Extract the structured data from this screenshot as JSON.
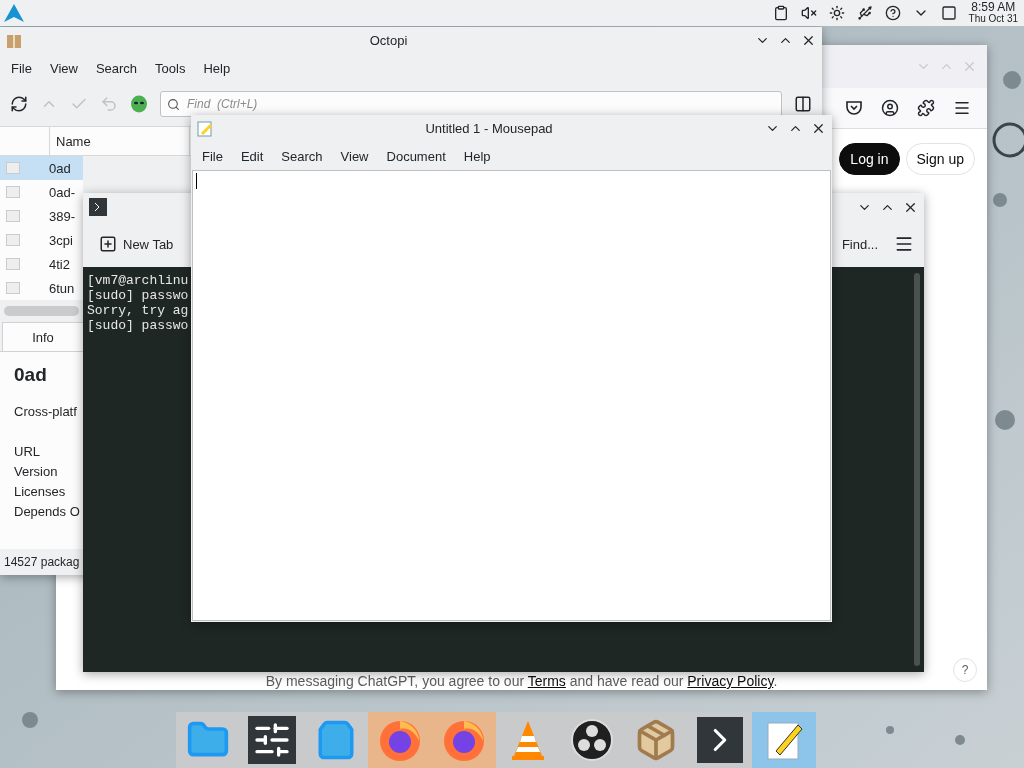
{
  "top_panel": {
    "time": "8:59 AM",
    "date": "Thu Oct 31"
  },
  "browser": {
    "buttons": [
      {
        "label": "Log in",
        "kind": "primary"
      },
      {
        "label": "Sign up",
        "kind": "secondary"
      }
    ],
    "footer": {
      "before": "By messaging ChatGPT, you agree to our ",
      "terms": "Terms",
      "middle": " and have read our ",
      "privacy": "Privacy Policy",
      "after": "."
    },
    "help": "?"
  },
  "octopi": {
    "title": "Octopi",
    "menu": [
      "File",
      "View",
      "Search",
      "Tools",
      "Help"
    ],
    "search": {
      "placeholder": "Find  (Ctrl+L)"
    },
    "column": "Name",
    "rows": [
      {
        "name": "0ad",
        "selected": true
      },
      {
        "name": "0ad-",
        "selected": false
      },
      {
        "name": "389-",
        "selected": false
      },
      {
        "name": "3cpi",
        "selected": false
      },
      {
        "name": "4ti2",
        "selected": false
      },
      {
        "name": "6tun",
        "selected": false
      }
    ],
    "info_tab": "Info",
    "package": "0ad",
    "description": "Cross-platf",
    "fields": [
      "URL",
      "Version",
      "Licenses",
      "Depends O"
    ],
    "status": "14527 packag"
  },
  "terminal": {
    "new_tab": "New Tab",
    "find": "Find...",
    "lines": [
      "[vm7@archlinu",
      "[sudo] passwo",
      "Sorry, try ag",
      "[sudo] passwo"
    ]
  },
  "mousepad": {
    "title": "Untitled 1 - Mousepad",
    "menu": [
      "File",
      "Edit",
      "Search",
      "View",
      "Document",
      "Help"
    ]
  },
  "dock": [
    {
      "kind": "folder",
      "selected": false,
      "attention": false
    },
    {
      "kind": "settings",
      "selected": false,
      "attention": false
    },
    {
      "kind": "store",
      "selected": false,
      "attention": false
    },
    {
      "kind": "firefox",
      "selected": false,
      "attention": true
    },
    {
      "kind": "firefox",
      "selected": false,
      "attention": true
    },
    {
      "kind": "vlc",
      "selected": false,
      "attention": false
    },
    {
      "kind": "obs",
      "selected": false,
      "attention": false
    },
    {
      "kind": "package",
      "selected": false,
      "attention": false
    },
    {
      "kind": "terminal",
      "selected": false,
      "attention": false
    },
    {
      "kind": "editor",
      "selected": true,
      "attention": false
    }
  ]
}
